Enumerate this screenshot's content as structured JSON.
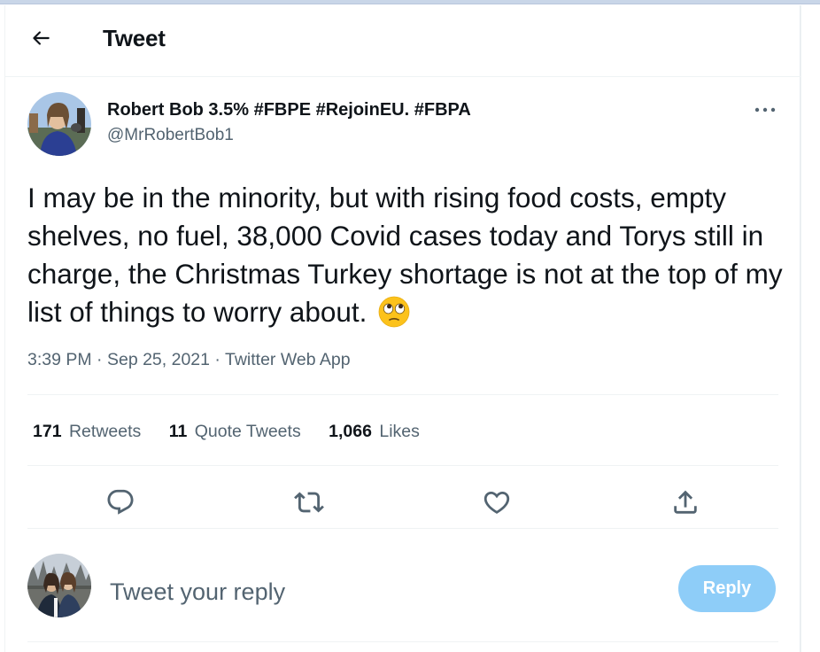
{
  "header": {
    "title": "Tweet"
  },
  "tweet": {
    "author_name": "Robert Bob 3.5% #FBPE #RejoinEU. #FBPA",
    "author_handle": "@MrRobertBob1",
    "text": "I may be in the minority, but with rising food costs, empty shelves, no fuel, 38,000 Covid cases today and Torys still in charge, the Christmas Turkey shortage is not at the top of my list of things to worry about.",
    "emoji": "face-with-rolling-eyes",
    "time": "3:39 PM",
    "date": "Sep 25, 2021",
    "source": "Twitter Web App",
    "separator": " · "
  },
  "stats": {
    "retweets_count": "171",
    "retweets_label": "Retweets",
    "quotes_count": "11",
    "quotes_label": "Quote Tweets",
    "likes_count": "1,066",
    "likes_label": "Likes"
  },
  "actions": [
    "reply-icon",
    "retweet-icon",
    "like-icon",
    "share-icon"
  ],
  "reply": {
    "placeholder": "Tweet your reply",
    "button_label": "Reply"
  },
  "colors": {
    "text": "#0f1419",
    "secondary": "#536471",
    "border": "#eff3f4",
    "reply_button_disabled": "#8ecdf8"
  }
}
